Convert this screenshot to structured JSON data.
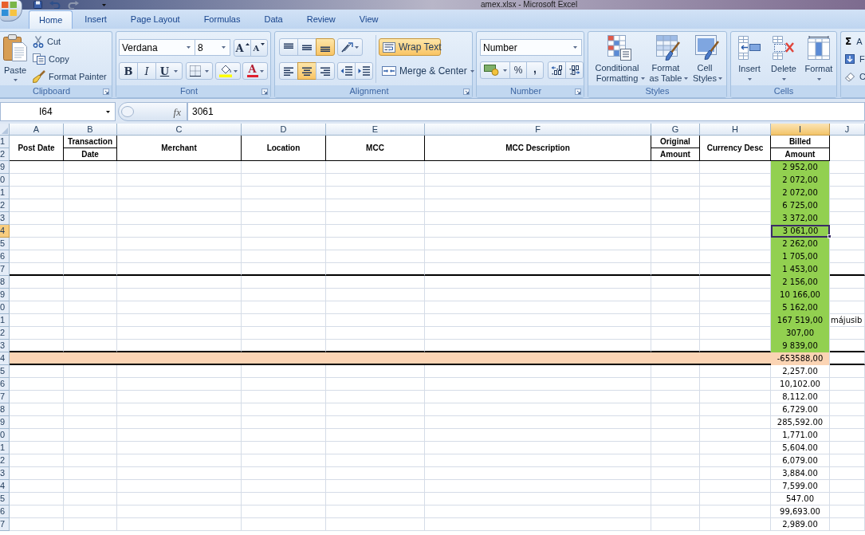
{
  "window": {
    "title": "amex.xlsx - Microsoft Excel"
  },
  "ribbon_tabs": [
    {
      "label": "Home",
      "selected": true
    },
    {
      "label": "Insert",
      "selected": false
    },
    {
      "label": "Page Layout",
      "selected": false
    },
    {
      "label": "Formulas",
      "selected": false
    },
    {
      "label": "Data",
      "selected": false
    },
    {
      "label": "Review",
      "selected": false
    },
    {
      "label": "View",
      "selected": false
    }
  ],
  "ribbon": {
    "clipboard": {
      "label": "Clipboard",
      "paste": "Paste",
      "actions": [
        {
          "kind": "cut",
          "label": "Cut"
        },
        {
          "kind": "copy",
          "label": "Copy"
        },
        {
          "kind": "format-painter",
          "label": "Format Painter"
        }
      ]
    },
    "font": {
      "label": "Font",
      "font_name": "Verdana",
      "font_size": "8",
      "size_buttons": [
        {
          "kind": "grow",
          "label": "A"
        },
        {
          "kind": "shrink",
          "label": "A"
        }
      ],
      "style_buttons": [
        {
          "kind": "bold",
          "label": "B"
        },
        {
          "kind": "italic",
          "label": "I"
        },
        {
          "kind": "underline",
          "label": "U"
        }
      ],
      "font_color": "A"
    },
    "alignment": {
      "label": "Alignment",
      "vertical": [
        {
          "kind": "top",
          "selected": false
        },
        {
          "kind": "middle",
          "selected": false
        },
        {
          "kind": "bottom",
          "selected": true
        }
      ],
      "horizontal": [
        {
          "kind": "left",
          "selected": false
        },
        {
          "kind": "center",
          "selected": true
        },
        {
          "kind": "right",
          "selected": false
        }
      ],
      "wrap_text": {
        "label": "Wrap Text",
        "selected": true
      },
      "merge": {
        "label": "Merge & Center"
      }
    },
    "number": {
      "label": "Number",
      "format": "Number",
      "symbols": [
        {
          "kind": "percent",
          "label": "%"
        },
        {
          "kind": "comma",
          "label": ","
        }
      ]
    },
    "styles": {
      "label": "Styles",
      "buttons": [
        {
          "kind": "conditional",
          "label": "Conditional Formatting"
        },
        {
          "kind": "table",
          "label": "Format as Table"
        },
        {
          "kind": "cell",
          "label": "Cell Styles"
        }
      ]
    },
    "cells": {
      "label": "Cells",
      "buttons": [
        {
          "kind": "insert",
          "label": "Insert"
        },
        {
          "kind": "delete",
          "label": "Delete"
        },
        {
          "kind": "format",
          "label": "Format"
        }
      ]
    },
    "editing": {
      "buttons": [
        {
          "kind": "sum",
          "symbol": "Σ",
          "label": "A"
        },
        {
          "kind": "fill",
          "label": "F"
        },
        {
          "kind": "clear",
          "label": "C"
        }
      ]
    }
  },
  "formula_bar": {
    "name_box": "I64",
    "function_label": "fx",
    "formula": "3061"
  },
  "sheet": {
    "columns": [
      {
        "label": "A",
        "selected": false
      },
      {
        "label": "B",
        "selected": false
      },
      {
        "label": "C",
        "selected": false
      },
      {
        "label": "D",
        "selected": false
      },
      {
        "label": "E",
        "selected": false
      },
      {
        "label": "F",
        "selected": false
      },
      {
        "label": "G",
        "selected": false
      },
      {
        "label": "H",
        "selected": false
      },
      {
        "label": "I",
        "selected": true
      },
      {
        "label": "J",
        "selected": false
      }
    ],
    "header_rows": {
      "numbers": [
        "1",
        "2"
      ],
      "cells": [
        {
          "kind": "merged",
          "text": "Post Date"
        },
        {
          "kind": "split",
          "top": "Transaction",
          "bottom": "Date"
        },
        {
          "kind": "merged",
          "text": "Merchant"
        },
        {
          "kind": "merged",
          "text": "Location"
        },
        {
          "kind": "merged",
          "text": "MCC"
        },
        {
          "kind": "merged",
          "text": "MCC Description"
        },
        {
          "kind": "split",
          "top": "Original",
          "bottom": "Amount"
        },
        {
          "kind": "merged",
          "text": "Currency Desc"
        },
        {
          "kind": "split",
          "top": "Billed",
          "bottom": "Amount"
        }
      ]
    },
    "rows": [
      {
        "number": "9",
        "selected": false,
        "kind": "entry",
        "billed": "2 952,00",
        "color": "#92d050",
        "border_below": false
      },
      {
        "number": "0",
        "selected": false,
        "kind": "entry",
        "billed": "2 072,00",
        "color": "#92d050",
        "border_below": false
      },
      {
        "number": "1",
        "selected": false,
        "kind": "entry",
        "billed": "2 072,00",
        "color": "#92d050",
        "border_below": false
      },
      {
        "number": "2",
        "selected": false,
        "kind": "entry",
        "billed": "6 725,00",
        "color": "#92d050",
        "border_below": false
      },
      {
        "number": "3",
        "selected": false,
        "kind": "entry",
        "billed": "3 372,00",
        "color": "#92d050",
        "border_below": false
      },
      {
        "number": "4",
        "selected": true,
        "kind": "entry",
        "billed": "3 061,00",
        "color": "#92d050",
        "border_below": false
      },
      {
        "number": "5",
        "selected": false,
        "kind": "entry",
        "billed": "2 262,00",
        "color": "#92d050",
        "border_below": false
      },
      {
        "number": "6",
        "selected": false,
        "kind": "entry",
        "billed": "1 705,00",
        "color": "#92d050",
        "border_below": false
      },
      {
        "number": "7",
        "selected": false,
        "kind": "entry",
        "billed": "1 453,00",
        "color": "#92d050",
        "border_below": true
      },
      {
        "number": "8",
        "selected": false,
        "kind": "entry",
        "billed": "2 156,00",
        "color": "#92d050",
        "border_below": false
      },
      {
        "number": "9",
        "selected": false,
        "kind": "entry",
        "billed": "10 166,00",
        "color": "#92d050",
        "border_below": false
      },
      {
        "number": "0",
        "selected": false,
        "kind": "entry",
        "billed": "5 162,00",
        "color": "#92d050",
        "border_below": false
      },
      {
        "number": "1",
        "selected": false,
        "kind": "entry",
        "billed": "167 519,00",
        "color": "#92d050",
        "border_below": false,
        "note": "májusib"
      },
      {
        "number": "2",
        "selected": false,
        "kind": "entry",
        "billed": "307,00",
        "color": "#92d050",
        "border_below": false
      },
      {
        "number": "3",
        "selected": false,
        "kind": "entry",
        "billed": "9 839,00",
        "color": "#92d050",
        "border_below": true
      },
      {
        "number": "4",
        "selected": false,
        "kind": "total",
        "billed": "-653588,00",
        "color": "#fbd4b4",
        "border_below": true
      },
      {
        "number": "5",
        "selected": false,
        "kind": "entry",
        "billed": "2,257.00",
        "border_below": false
      },
      {
        "number": "6",
        "selected": false,
        "kind": "entry",
        "billed": "10,102.00",
        "border_below": false
      },
      {
        "number": "7",
        "selected": false,
        "kind": "entry",
        "billed": "8,112.00",
        "border_below": false
      },
      {
        "number": "8",
        "selected": false,
        "kind": "entry",
        "billed": "6,729.00",
        "border_below": false
      },
      {
        "number": "9",
        "selected": false,
        "kind": "entry",
        "billed": "285,592.00",
        "border_below": false
      },
      {
        "number": "0",
        "selected": false,
        "kind": "entry",
        "billed": "1,771.00",
        "border_below": false
      },
      {
        "number": "1",
        "selected": false,
        "kind": "entry",
        "billed": "5,604.00",
        "border_below": false
      },
      {
        "number": "2",
        "selected": false,
        "kind": "entry",
        "billed": "6,079.00",
        "border_below": false
      },
      {
        "number": "3",
        "selected": false,
        "kind": "entry",
        "billed": "3,884.00",
        "border_below": false
      },
      {
        "number": "4",
        "selected": false,
        "kind": "entry",
        "billed": "7,599.00",
        "border_below": false
      },
      {
        "number": "5",
        "selected": false,
        "kind": "entry",
        "billed": "547.00",
        "border_below": false
      },
      {
        "number": "6",
        "selected": false,
        "kind": "entry",
        "billed": "99,693.00",
        "border_below": false
      },
      {
        "number": "7",
        "selected": false,
        "kind": "entry",
        "billed": "2,989.00",
        "border_below": false
      }
    ]
  }
}
